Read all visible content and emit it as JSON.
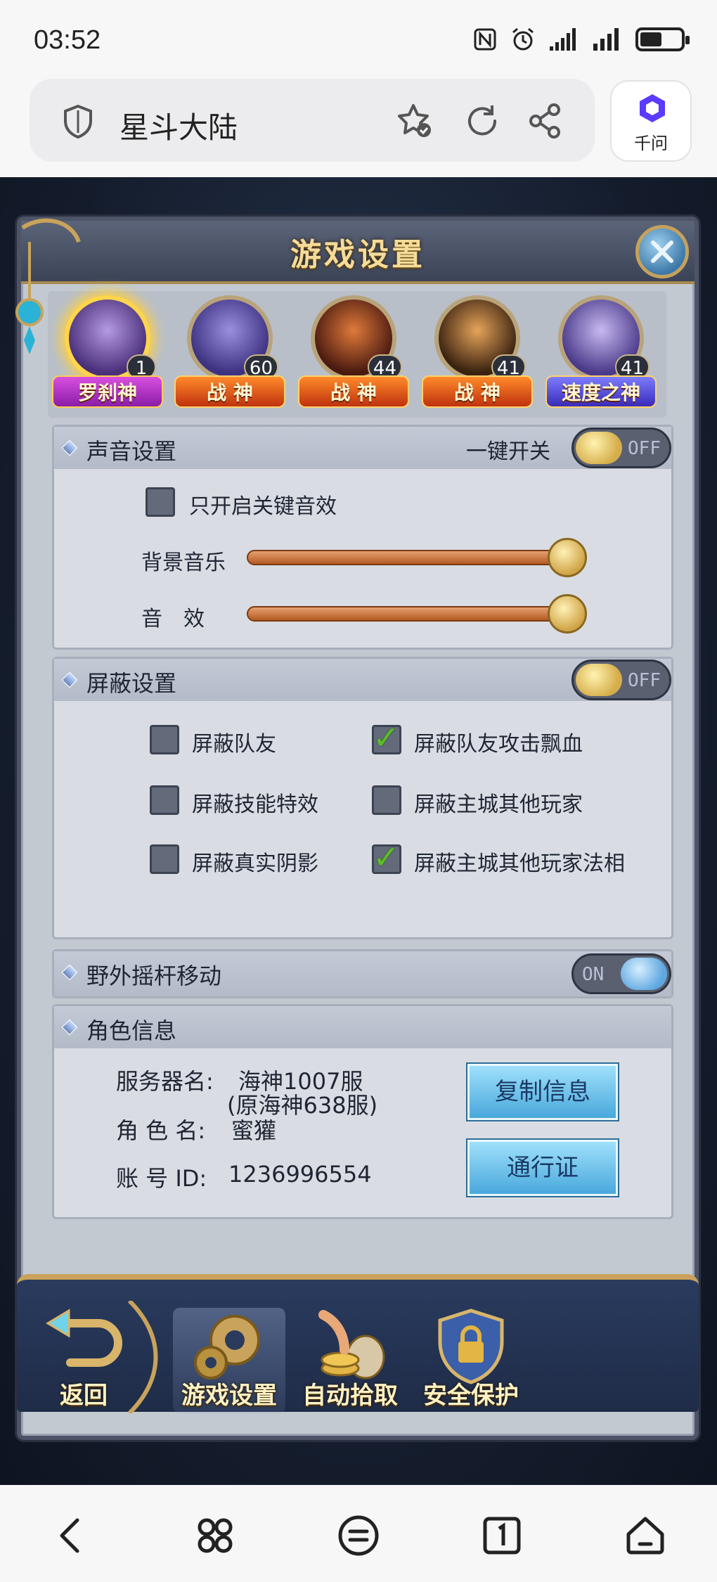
{
  "status_bar": {
    "time": "03:52"
  },
  "browser": {
    "title": "星斗大陆",
    "ai_label": "千问"
  },
  "game": {
    "panel_title": "游戏设置",
    "avatars": [
      {
        "level": "1",
        "badge": "罗刹神"
      },
      {
        "level": "60",
        "badge": "战 神"
      },
      {
        "level": "44",
        "badge": "战 神"
      },
      {
        "level": "41",
        "badge": "战 神"
      },
      {
        "level": "41",
        "badge": "速度之神"
      }
    ],
    "sound": {
      "title": "声音设置",
      "master_label": "一键开关",
      "master_state": "OFF",
      "key_only_label": "只开启关键音效",
      "bgm_label": "背景音乐",
      "bgm_level": 1.0,
      "sfx_label": "音　效",
      "sfx_level": 1.0
    },
    "shield": {
      "title": "屏蔽设置",
      "state": "OFF",
      "options": [
        {
          "label": "屏蔽队友",
          "checked": false
        },
        {
          "label": "屏蔽队友攻击飘血",
          "checked": true
        },
        {
          "label": "屏蔽技能特效",
          "checked": false
        },
        {
          "label": "屏蔽主城其他玩家",
          "checked": false
        },
        {
          "label": "屏蔽真实阴影",
          "checked": false
        },
        {
          "label": "屏蔽主城其他玩家法相",
          "checked": true
        }
      ]
    },
    "joystick": {
      "title": "野外摇杆移动",
      "state": "ON"
    },
    "role": {
      "title": "角色信息",
      "server_label": "服务器名:",
      "server_value": "海神1007服",
      "server_note": "(原海神638服)",
      "name_label": "角 色 名:",
      "name_value": "蜜獾",
      "account_label": "账 号 ID:",
      "account_value": "1236996554",
      "copy_button": "复制信息",
      "pass_button": "通行证"
    },
    "bottom_bar": {
      "back": "返回",
      "settings": "游戏设置",
      "auto_pick": "自动拾取",
      "security": "安全保护"
    }
  }
}
